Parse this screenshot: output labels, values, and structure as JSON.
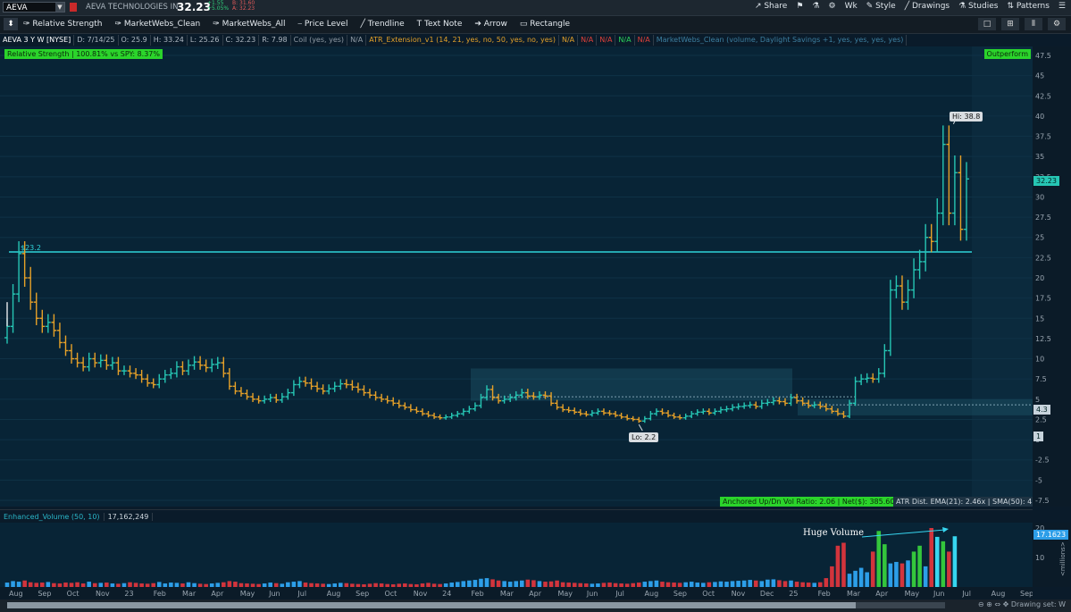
{
  "header": {
    "symbol": "AEVA",
    "company": "AEVA TECHNOLOGIES IN",
    "last": "32.23",
    "change": "+1.55",
    "change_pct": "+5.05%",
    "bid": "B: 31.60",
    "ask": "A: 32.23",
    "right_items": [
      "Share",
      "",
      "",
      "",
      "Wk",
      "",
      "Style",
      "Drawings",
      "Studies",
      "Patterns",
      ""
    ]
  },
  "toolbar": {
    "items": [
      "Relative Strength",
      "MarketWebs_Clean",
      "MarketWebs_All",
      "Price Level",
      "Trendline",
      "Text Note",
      "Arrow",
      "Rectangle"
    ]
  },
  "infobar": {
    "items": [
      {
        "text": "AEVA 3 Y W [NYSE]",
        "color": "#ffffff"
      },
      {
        "text": "D: 7/14/25",
        "color": "#aeb8c1"
      },
      {
        "text": "O: 25.9",
        "color": "#aeb8c1"
      },
      {
        "text": "H: 33.24",
        "color": "#aeb8c1"
      },
      {
        "text": "L: 25.26",
        "color": "#aeb8c1"
      },
      {
        "text": "C: 32.23",
        "color": "#aeb8c1"
      },
      {
        "text": "R: 7.98",
        "color": "#aeb8c1"
      },
      {
        "text": "Coil (yes, yes)",
        "color": "#8f9aa4"
      },
      {
        "text": "N/A",
        "color": "#8f9aa4"
      },
      {
        "text": "ATR_Extension_v1 (14, 21, yes, no, 50, yes, no, yes)",
        "color": "#e3a12a"
      },
      {
        "text": "N/A",
        "color": "#e3a12a"
      },
      {
        "text": "N/A",
        "color": "#e0413a"
      },
      {
        "text": "N/A",
        "color": "#e0413a"
      },
      {
        "text": "N/A",
        "color": "#2bd45a"
      },
      {
        "text": "N/A",
        "color": "#e0413a"
      },
      {
        "text": "MarketWebs_Clean (volume, Daylight Savings +1, yes, yes, yes, yes)",
        "color": "#3d7fa0"
      }
    ]
  },
  "labels": {
    "rel_strength": "Relative Strength | 100.81% vs SPY: 8.37%",
    "outperform": "Outperform",
    "hi": "Hi: 38.8",
    "lo": "Lo: 2.2",
    "level": "$23.2",
    "last_tag": "32.23",
    "tag_43": "4.3",
    "tag_1": "1",
    "anchored": "Anchored Up/Dn Vol Ratio: 2.06 | Net($): 385.60M",
    "atr_dist": "ATR Dist. EMA(21): 2.46x | SMA(50): 4.23x",
    "vol_study": "Enhanced_Volume (50, 10)",
    "vol_value": "17,162,249",
    "huge_volume": "Huge Volume",
    "vol_tag": "17.1623",
    "vol_unit": "<millions>",
    "drawing_set": "Drawing set: W"
  },
  "colors": {
    "up": "#26c6b4",
    "down": "#e7a128",
    "level_line": "#2fd3d8",
    "plot_bg": "#082436",
    "green_badge": "#2bd42b",
    "vol_green": "#34c63c",
    "vol_blue": "#2d9ee8",
    "vol_red": "#d2343c",
    "vol_cyan": "#37d6f0"
  },
  "chart_data": {
    "type": "candlestick",
    "timeframe": "weekly",
    "ylim": [
      -7.5,
      47.5
    ],
    "yticks": [
      47.5,
      45,
      42.5,
      40,
      37.5,
      35,
      32.5,
      30,
      27.5,
      25,
      22.5,
      20,
      17.5,
      15,
      12.5,
      10,
      7.5,
      5,
      2.5,
      0,
      -2.5,
      -5,
      -7.5
    ],
    "xticks": [
      "Aug",
      "Sep",
      "Oct",
      "Nov",
      "23",
      "Feb",
      "Mar",
      "Apr",
      "May",
      "Jun",
      "Jul",
      "Aug",
      "Sep",
      "Oct",
      "Nov",
      "24",
      "Feb",
      "Mar",
      "Apr",
      "May",
      "Jun",
      "Jul",
      "Aug",
      "Sep",
      "Oct",
      "Nov",
      "Dec",
      "25",
      "Feb",
      "Mar",
      "Apr",
      "May",
      "Jun",
      "Jul",
      "Aug",
      "Sep"
    ],
    "levels": [
      {
        "value": 23.2,
        "label": "$23.2"
      }
    ],
    "close": [
      14,
      18,
      23,
      20,
      17,
      15,
      14,
      14.5,
      13.5,
      12,
      11,
      10,
      9.5,
      9,
      10,
      9.5,
      9.8,
      9.2,
      9.5,
      8.5,
      8.5,
      8.2,
      8,
      7.5,
      7,
      6.8,
      7.5,
      8,
      8.2,
      9,
      8.5,
      9.2,
      9.6,
      9.2,
      8.9,
      9.3,
      9.5,
      8.2,
      6.6,
      6,
      5.7,
      5.3,
      5,
      4.8,
      5,
      5.2,
      4.9,
      5.3,
      5.8,
      6.8,
      7.2,
      7,
      6.6,
      6.3,
      6,
      6.3,
      6.6,
      6.9,
      6.8,
      6.5,
      6.2,
      5.8,
      5.5,
      5.2,
      5,
      4.8,
      4.5,
      4.2,
      4,
      3.7,
      3.5,
      3.2,
      3,
      2.8,
      2.7,
      2.8,
      3,
      3.2,
      3.5,
      3.8,
      4.2,
      5.2,
      6.2,
      5.2,
      4.8,
      5,
      5.2,
      5.5,
      5.8,
      5.4,
      5.3,
      5.5,
      5.4,
      4.5,
      4,
      3.7,
      3.6,
      3.4,
      3.2,
      3.1,
      3.3,
      3.5,
      3.3,
      3.2,
      3,
      2.8,
      2.6,
      2.5,
      2.3,
      2.6,
      3.2,
      3.5,
      3.3,
      3,
      2.8,
      2.7,
      2.9,
      3.2,
      3.4,
      3.5,
      3.3,
      3.5,
      3.7,
      3.8,
      4,
      4.1,
      4.2,
      4.3,
      4.1,
      4.5,
      4.6,
      4.8,
      4.7,
      4.5,
      5.2,
      4.8,
      4.5,
      4.2,
      4.3,
      4.1,
      3.8,
      3.5,
      3.2,
      2.9,
      4.5,
      7.2,
      7.5,
      7.6,
      7.5,
      8.2,
      11,
      18.5,
      19,
      17,
      18.5,
      21,
      22,
      25,
      24.5,
      28,
      36.5,
      28,
      33,
      26,
      32.23
    ],
    "hi": 38.8,
    "lo": 2.2,
    "volume_ylim": [
      0,
      20
    ],
    "volume_yticks": [
      20,
      10
    ],
    "volume_millions": [
      1.5,
      2,
      1.8,
      2.2,
      1.6,
      1.4,
      1.5,
      1.7,
      1.3,
      1.2,
      1.5,
      1.4,
      1.6,
      1.2,
      1.8,
      1.3,
      1.4,
      1.5,
      1.2,
      1.1,
      1.3,
      1.6,
      1.4,
      1.2,
      1.1,
      1.3,
      1.7,
      1.2,
      1.5,
      1.4,
      1.2,
      1.6,
      1.3,
      1.1,
      1,
      1.2,
      1.4,
      1.6,
      2,
      1.8,
      1.3,
      1.2,
      1.1,
      1,
      1.2,
      1.5,
      1.3,
      1.1,
      1.6,
      1.8,
      2,
      1.5,
      1.3,
      1.2,
      1.1,
      1,
      1.2,
      1.4,
      1.3,
      1.1,
      1,
      0.9,
      1.1,
      1.3,
      1.2,
      1,
      0.9,
      1.1,
      1.2,
      1,
      0.9,
      1.2,
      1.4,
      1.1,
      1,
      1.2,
      1.5,
      1.7,
      2,
      2.2,
      2.4,
      2.8,
      3,
      2.6,
      2.2,
      2,
      1.8,
      2,
      2.2,
      2.5,
      2.3,
      2,
      1.8,
      1.9,
      2.2,
      1.6,
      1.5,
      1.4,
      1.3,
      1.2,
      1.1,
      1.2,
      1.4,
      1.5,
      1.3,
      1.2,
      1.1,
      1.3,
      1.5,
      1.8,
      2,
      2.2,
      1.8,
      1.6,
      1.5,
      1.4,
      1.6,
      1.8,
      1.5,
      1.4,
      1.6,
      1.7,
      1.9,
      1.8,
      2,
      2.1,
      2.2,
      2.4,
      2.2,
      2,
      2.5,
      2.6,
      2.3,
      2,
      2.2,
      1.8,
      1.6,
      1.5,
      1.4,
      1.6,
      3,
      7,
      14,
      15,
      4.5,
      5.5,
      6.5,
      5,
      12,
      19,
      14.5,
      8,
      8.5,
      8,
      9,
      12,
      14,
      7,
      20,
      17,
      15.5,
      12,
      17.2
    ]
  }
}
